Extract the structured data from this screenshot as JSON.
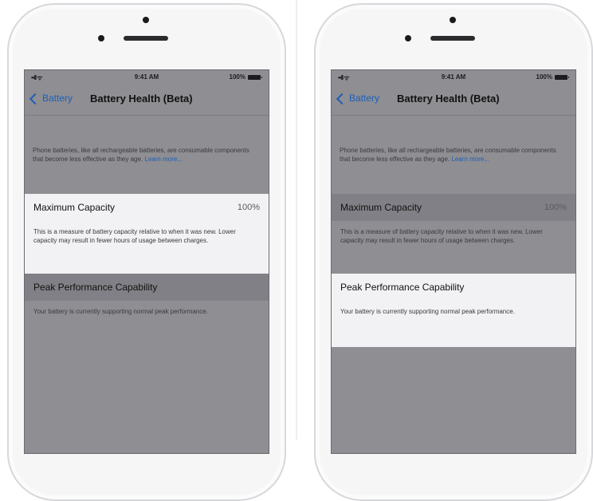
{
  "screens": [
    {
      "status": {
        "signal": "••ll",
        "wifi": "ᯤ",
        "time": "9:41 AM",
        "battery": "100%"
      },
      "nav": {
        "back_label": "Battery",
        "title": "Battery Health (Beta)"
      },
      "intro": {
        "text": "Phone batteries, like all rechargeable batteries, are consumable components that become less effective as they age.",
        "link": "Learn more..."
      },
      "max_capacity": {
        "label": "Maximum Capacity",
        "value": "100%",
        "description": "This is a measure of battery capacity relative to when it was new. Lower capacity may result in fewer hours of usage between charges."
      },
      "peak": {
        "label": "Peak Performance Capability",
        "description": "Your battery is currently supporting normal peak performance."
      },
      "highlighted_section": "max_capacity"
    },
    {
      "status": {
        "signal": "••ll",
        "wifi": "ᯤ",
        "time": "9:41 AM",
        "battery": "100%"
      },
      "nav": {
        "back_label": "Battery",
        "title": "Battery Health (Beta)"
      },
      "intro": {
        "text": "Phone batteries, like all rechargeable batteries, are consumable components that become less effective as they age.",
        "link": "Learn more..."
      },
      "max_capacity": {
        "label": "Maximum Capacity",
        "value": "100%",
        "description": "This is a measure of battery capacity relative to when it was new. Lower capacity may result in fewer hours of usage between charges."
      },
      "peak": {
        "label": "Peak Performance Capability",
        "description": "Your battery is currently supporting normal peak performance."
      },
      "highlighted_section": "peak"
    }
  ],
  "colors": {
    "link": "#1e5fb6",
    "screen_dim": "#8e8e93",
    "highlight": "#f2f2f4",
    "phone_body": "#f6f6f7"
  },
  "icons": {
    "back": "chevron-left-icon",
    "battery": "battery-full-icon",
    "signal": "cellular-signal-icon",
    "wifi": "wifi-icon"
  }
}
